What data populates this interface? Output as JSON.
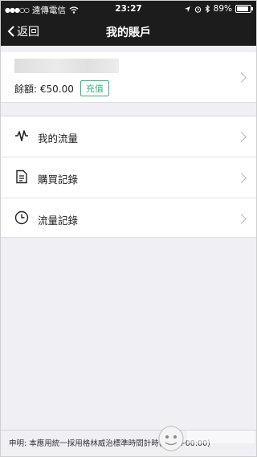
{
  "status_bar": {
    "carrier": "遠傳電信",
    "time": "23:27",
    "battery": "89%",
    "battery_level": 0.89
  },
  "nav": {
    "back_label": "返回",
    "title": "我的賬戶"
  },
  "account": {
    "balance_label": "餘額: €50.00",
    "topup_label": "充值"
  },
  "menu": {
    "items": [
      {
        "label": "我的流量",
        "icon": "pulse-icon"
      },
      {
        "label": "購買記錄",
        "icon": "document-icon"
      },
      {
        "label": "流量記錄",
        "icon": "clock-icon"
      }
    ]
  },
  "footer": {
    "disclaimer": "申明: 本應用統一採用格林威治標準時間計時(GMT+00:00)"
  },
  "colors": {
    "bar": "#1c1c1c",
    "accent": "#2fb87c",
    "background": "#efeff4"
  }
}
